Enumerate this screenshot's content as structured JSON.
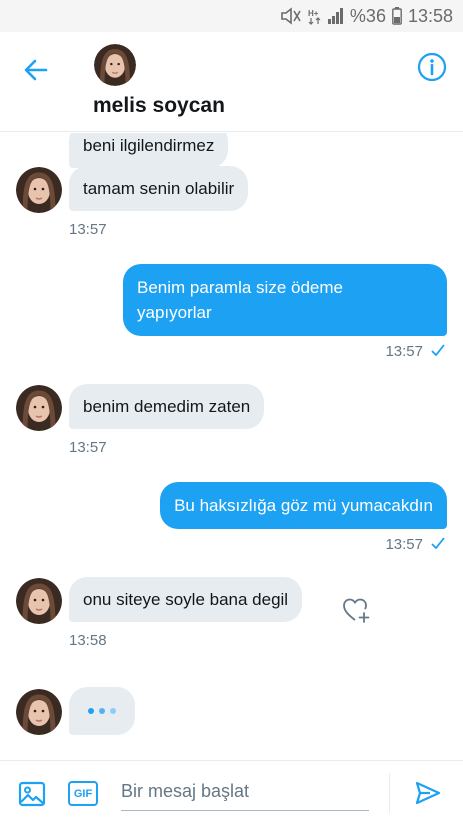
{
  "status_bar": {
    "icons": [
      "mute-icon",
      "signal-hplus-icon",
      "cell-signal-icon",
      "battery-icon"
    ],
    "battery_text": "%36",
    "time": "13:58"
  },
  "header": {
    "back_icon": "arrow-left-icon",
    "name": "melis soycan",
    "info_icon": "info-icon"
  },
  "conversation": {
    "messages": [
      {
        "direction": "in",
        "text": "beni ilgilendirmez"
      },
      {
        "direction": "in",
        "text": "tamam senin olabilir",
        "time": "13:57"
      },
      {
        "direction": "out",
        "text_line1": "Benim paramla size ödeme",
        "text_line2": "yapıyorlar",
        "time": "13:57",
        "status": "check-icon"
      },
      {
        "direction": "in",
        "text": "benim demedim zaten",
        "time": "13:57"
      },
      {
        "direction": "out",
        "text": "Bu haksızlığa göz mü yumacakdın",
        "time": "13:57",
        "status": "check-icon"
      },
      {
        "direction": "in",
        "text": "onu siteye soyle bana degil",
        "time": "13:58",
        "action_icon": "heart-plus-icon"
      },
      {
        "direction": "in",
        "typing": true
      }
    ]
  },
  "composer": {
    "placeholder": "Bir mesaj başlat",
    "gif_label": "GIF",
    "icons": [
      "image-icon",
      "gif-icon",
      "send-icon"
    ]
  },
  "colors": {
    "accent": "#1da1f2",
    "incoming_bubble": "#e6ecf0",
    "muted_text": "#657786"
  }
}
